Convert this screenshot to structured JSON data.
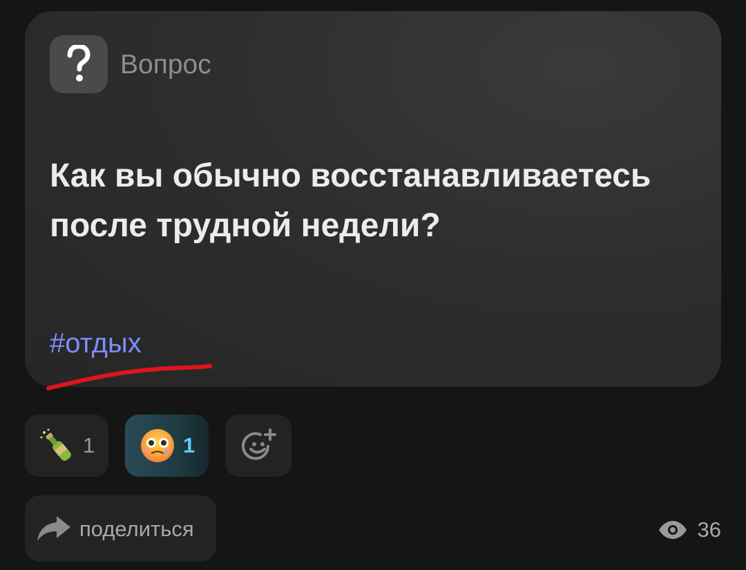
{
  "post": {
    "type_label": "Вопрос",
    "type_icon": "question-mark-icon",
    "title": "Как вы обычно восстанавливаетесь после трудной недели?",
    "hashtag": "#отдых"
  },
  "reactions": [
    {
      "emoji": "champagne-bottle-icon",
      "count": "1",
      "selected": false
    },
    {
      "emoji": "face-holding-back-tears-icon",
      "count": "1",
      "selected": true
    }
  ],
  "add_reaction": {
    "icon": "add-reaction-smiley-icon"
  },
  "actions": {
    "share_label": "поделиться",
    "share_icon": "share-arrow-icon"
  },
  "stats": {
    "views_icon": "eye-icon",
    "views": "36"
  },
  "colors": {
    "background": "#151515",
    "card": "#2e2e2e",
    "hashtag": "#7f8cff",
    "selected_count": "#64c8ff",
    "annotation_stroke": "#e0141e"
  }
}
